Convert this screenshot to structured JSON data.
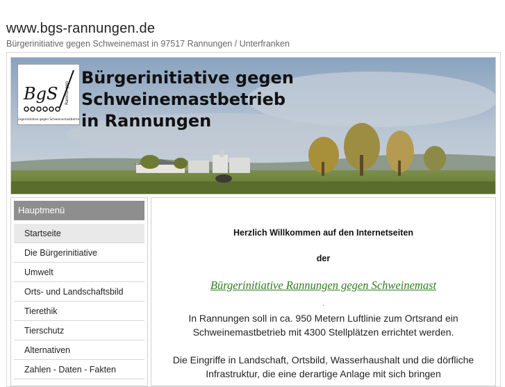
{
  "site": {
    "title": "www.bgs-rannungen.de",
    "subtitle": "Bürgerinitiative gegen Schweinemast in 97517 Rannungen / Unterfranken"
  },
  "banner": {
    "title_line1": "Bürgerinitiative gegen Schweinemastbetrieb",
    "title_line2": "in Rannungen",
    "logo": {
      "mark": "BgS",
      "vertical_text": "Rannungen",
      "caption": "Bürgerinitiative gegen Schweinemastbetrieb"
    }
  },
  "menu": {
    "header": "Hauptmenü",
    "items": [
      {
        "label": "Startseite",
        "active": true
      },
      {
        "label": "Die Bürgerinitiative"
      },
      {
        "label": "Umwelt"
      },
      {
        "label": "Orts- und Landschaftsbild"
      },
      {
        "label": "Tierethik"
      },
      {
        "label": "Tierschutz"
      },
      {
        "label": "Alternativen"
      },
      {
        "label": "Zahlen - Daten - Fakten"
      }
    ]
  },
  "content": {
    "welcome": "Herzlich Willkommen auf den Internetseiten",
    "der": "der",
    "org_link": "Bürgerinitiative Rannungen gegen Schweinemast",
    "separator": ".",
    "para1": "In Rannungen soll in ca. 950 Metern Luftlinie zum Ortsrand ein Schweinemastbetrieb mit 4300 Stellplätzen errichtet werden.",
    "para2": "Die Eingriffe in Landschaft, Ortsbild, Wasserhaushalt und die dörfliche Infrastruktur, die eine derartige Anlage mit sich bringen"
  },
  "colors": {
    "link_green": "#2e7d1e",
    "menu_header_bg": "#8e8e8e",
    "active_item_bg": "#e9e9e9"
  }
}
